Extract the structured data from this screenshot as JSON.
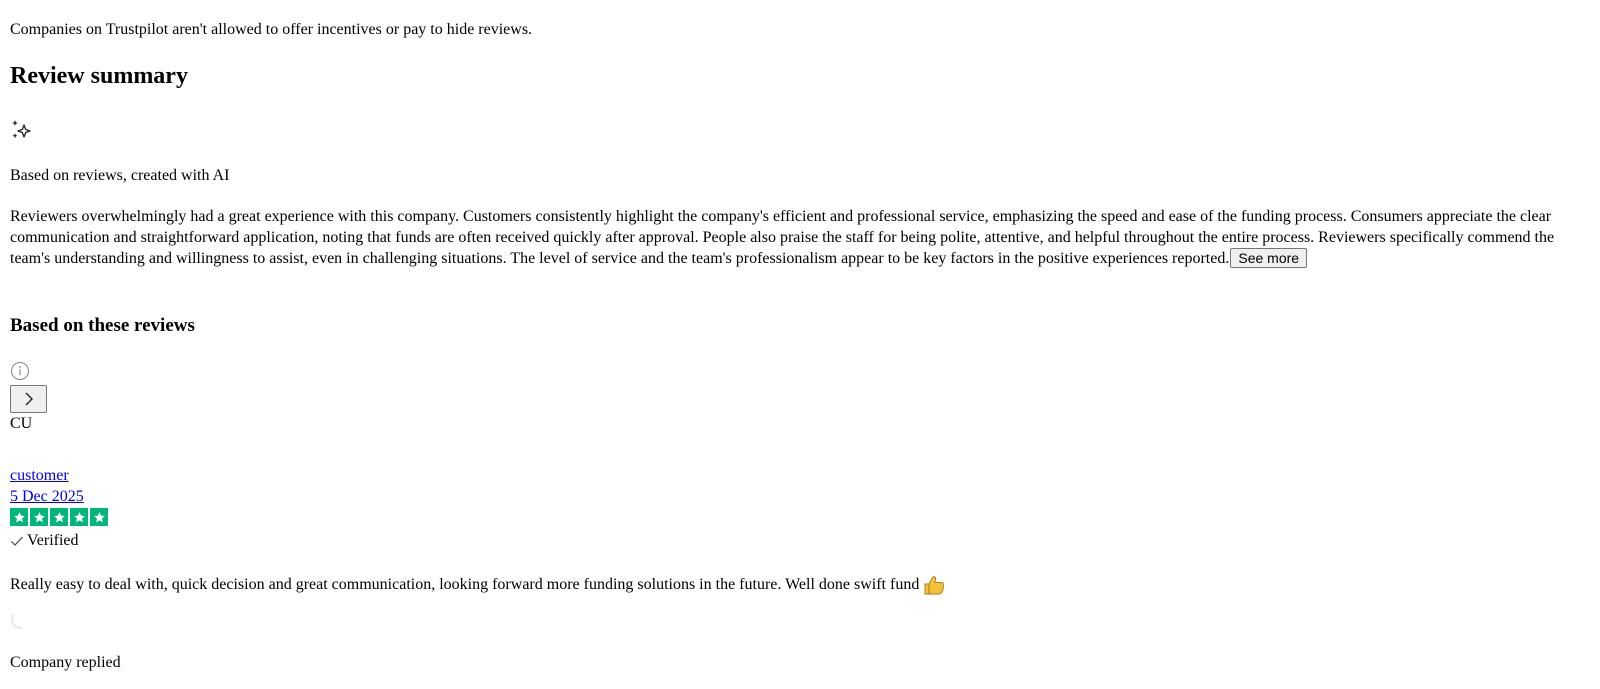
{
  "notice": "Companies on Trustpilot aren't allowed to offer incentives or pay to hide reviews.",
  "summary": {
    "heading": "Review summary",
    "sparkle_icon": "sparkles-icon",
    "based_on_ai": "Based on reviews, created with AI",
    "text": "Reviewers overwhelmingly had a great experience with this company. Customers consistently highlight the company's efficient and professional service, emphasizing the speed and ease of the funding process. Consumers appreciate the clear communication and straightforward application, noting that funds are often received quickly after approval. People also praise the staff for being polite, attentive, and helpful throughout the entire process. Reviewers specifically commend the team's understanding and willingness to assist, even in challenging situations. The level of service and the team's professionalism appear to be key factors in the positive experiences reported.",
    "see_more_label": "See more"
  },
  "reviews_section": {
    "heading": "Based on these reviews",
    "info_icon": "info-icon",
    "next_icon": "chevron-right-icon"
  },
  "review": {
    "avatar_initials": "CU",
    "reviewer_name": "customer",
    "date": "5 Dec 2025",
    "rating": 5,
    "rating_max": 5,
    "star_color": "#00b67a",
    "verified_label": "Verified",
    "text": "Really easy to deal with, quick decision and great communication, looking forward more funding solutions in the future. Well done swift fund",
    "emoji_icon": "thumbs-up-icon",
    "company_replied": "Company replied"
  }
}
